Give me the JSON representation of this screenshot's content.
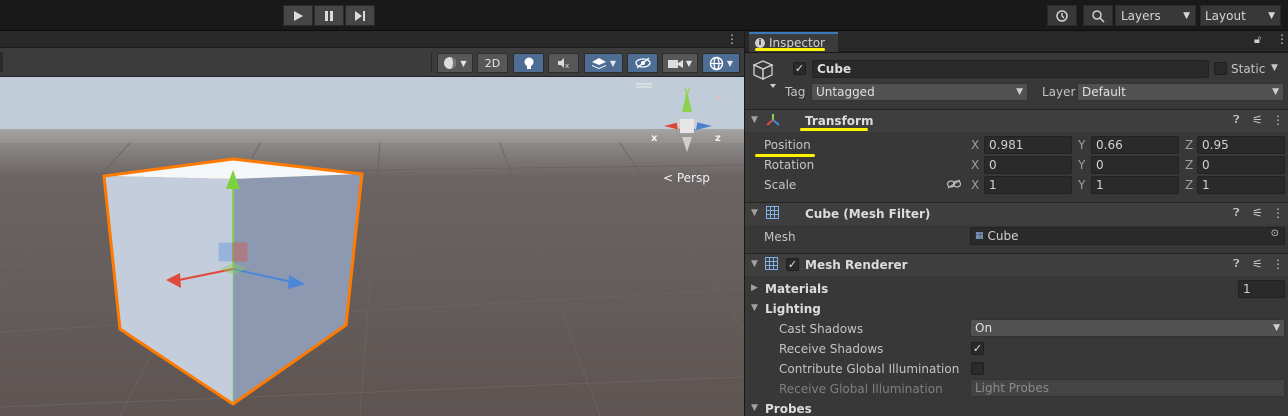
{
  "toolbar": {
    "play_icon": "play-icon",
    "pause_icon": "pause-icon",
    "step_icon": "step-icon",
    "history_icon": "history-icon",
    "search_icon": "search-icon",
    "layers_label": "Layers",
    "layout_label": "Layout"
  },
  "scene": {
    "btn_2d": "2D",
    "persp_label": "< Persp",
    "axis_x": "x",
    "axis_z": "z",
    "axis_y": "y"
  },
  "inspector": {
    "tab_label": "Inspector",
    "object_name": "Cube",
    "static_label": "Static",
    "tag_label": "Tag",
    "tag_value": "Untagged",
    "layer_label": "Layer",
    "layer_value": "Default",
    "transform": {
      "title": "Transform",
      "position_label": "Position",
      "rotation_label": "Rotation",
      "scale_label": "Scale",
      "axis_x": "X",
      "axis_y": "Y",
      "axis_z": "Z",
      "position": {
        "x": "0.981",
        "y": "0.66",
        "z": "0.95"
      },
      "rotation": {
        "x": "0",
        "y": "0",
        "z": "0"
      },
      "scale": {
        "x": "1",
        "y": "1",
        "z": "1"
      }
    },
    "mesh_filter": {
      "title": "Cube (Mesh Filter)",
      "mesh_label": "Mesh",
      "mesh_value": "Cube"
    },
    "mesh_renderer": {
      "title": "Mesh Renderer",
      "materials_label": "Materials",
      "materials_count": "1",
      "lighting_label": "Lighting",
      "cast_shadows_label": "Cast Shadows",
      "cast_shadows_value": "On",
      "receive_shadows_label": "Receive Shadows",
      "contribute_gi_label": "Contribute Global Illumination",
      "receive_gi_label": "Receive Global Illumination",
      "receive_gi_value": "Light Probes",
      "probes_label": "Probes"
    }
  },
  "colors": {
    "highlight": "#fff200",
    "selection_outline": "#ff7a00",
    "accent_blue": "#3a79bb"
  }
}
